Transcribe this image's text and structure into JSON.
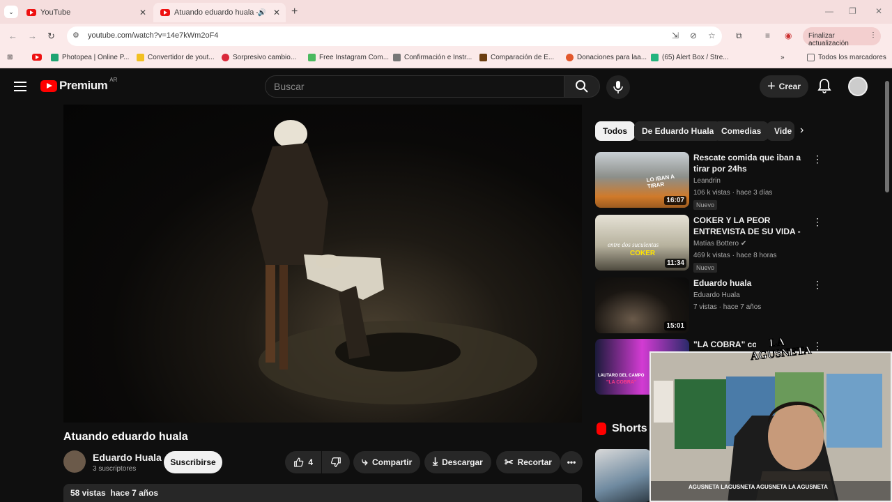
{
  "browser": {
    "tabs": [
      {
        "title": "YouTube"
      },
      {
        "title": "Atuando eduardo huala - YouTube"
      }
    ],
    "url": "youtube.com/watch?v=14e7kWm2oF4",
    "update_label": "Finalizar actualización",
    "bookmarks": [
      {
        "label": "Photopea | Online P...",
        "color": "#1ea472"
      },
      {
        "label": "Convertidor de yout...",
        "color": "#f2c021"
      },
      {
        "label": "Sorpresivo cambio...",
        "color": "#d9283a"
      },
      {
        "label": "Free Instagram Com...",
        "color": "#4bb95f"
      },
      {
        "label": "Confirmación e Instr...",
        "color": "#777777"
      },
      {
        "label": "Comparación de E...",
        "color": "#6b3d10"
      },
      {
        "label": "Donaciones para laa...",
        "color": "#e2572b"
      },
      {
        "label": "(65) Alert Box / Stre...",
        "color": "#24b47e"
      }
    ],
    "all_bookmarks_label": "Todos los marcadores"
  },
  "youtube": {
    "logo_text": "Premium",
    "country_code": "AR",
    "search_placeholder": "Buscar",
    "create_label": "Crear",
    "video": {
      "title": "Atuando eduardo huala",
      "channel": "Eduardo Huala",
      "subscribers": "3 suscriptores",
      "subscribe_label": "Suscribirse",
      "likes": "4",
      "share_label": "Compartir",
      "download_label": "Descargar",
      "clip_label": "Recortar",
      "views": "58 vistas",
      "age": "hace 7 años"
    },
    "chips": [
      "Todos",
      "De Eduardo Huala",
      "Comedias",
      "Vide"
    ],
    "recommendations": [
      {
        "title": "Rescate comida que iban a tirar por 24hs",
        "channel": "Leandrin",
        "meta": "106 k vistas · hace 3 días",
        "badge": "Nuevo",
        "duration": "16:07",
        "thumb_text": "LO IBAN A TIRAR"
      },
      {
        "title": "COKER Y LA PEOR ENTREVISTA DE SU VIDA - ENTRE DOS ...",
        "channel": "Matías Bottero",
        "meta": "469 k vistas · hace 8 horas",
        "badge": "Nuevo",
        "duration": "11:34",
        "thumb_text": "entre dos suculentas",
        "thumb_sub": "COKER"
      },
      {
        "title": "Eduardo huala",
        "channel": "Eduardo Huala",
        "meta": "7 vistas · hace 7 años",
        "duration": "15:01"
      },
      {
        "title": "\"LA COBRA\" con Juan",
        "thumb_text": "LAUTARO DEL CAMPO",
        "thumb_sub": "\"LA COBRA\""
      }
    ],
    "shorts_label": "Shorts"
  },
  "overlay": {
    "brand": "LA AGUSNETA",
    "socials": "AGUSNETA  LAGUSNETA  AGUSNETA  LA AGUSNETA"
  }
}
